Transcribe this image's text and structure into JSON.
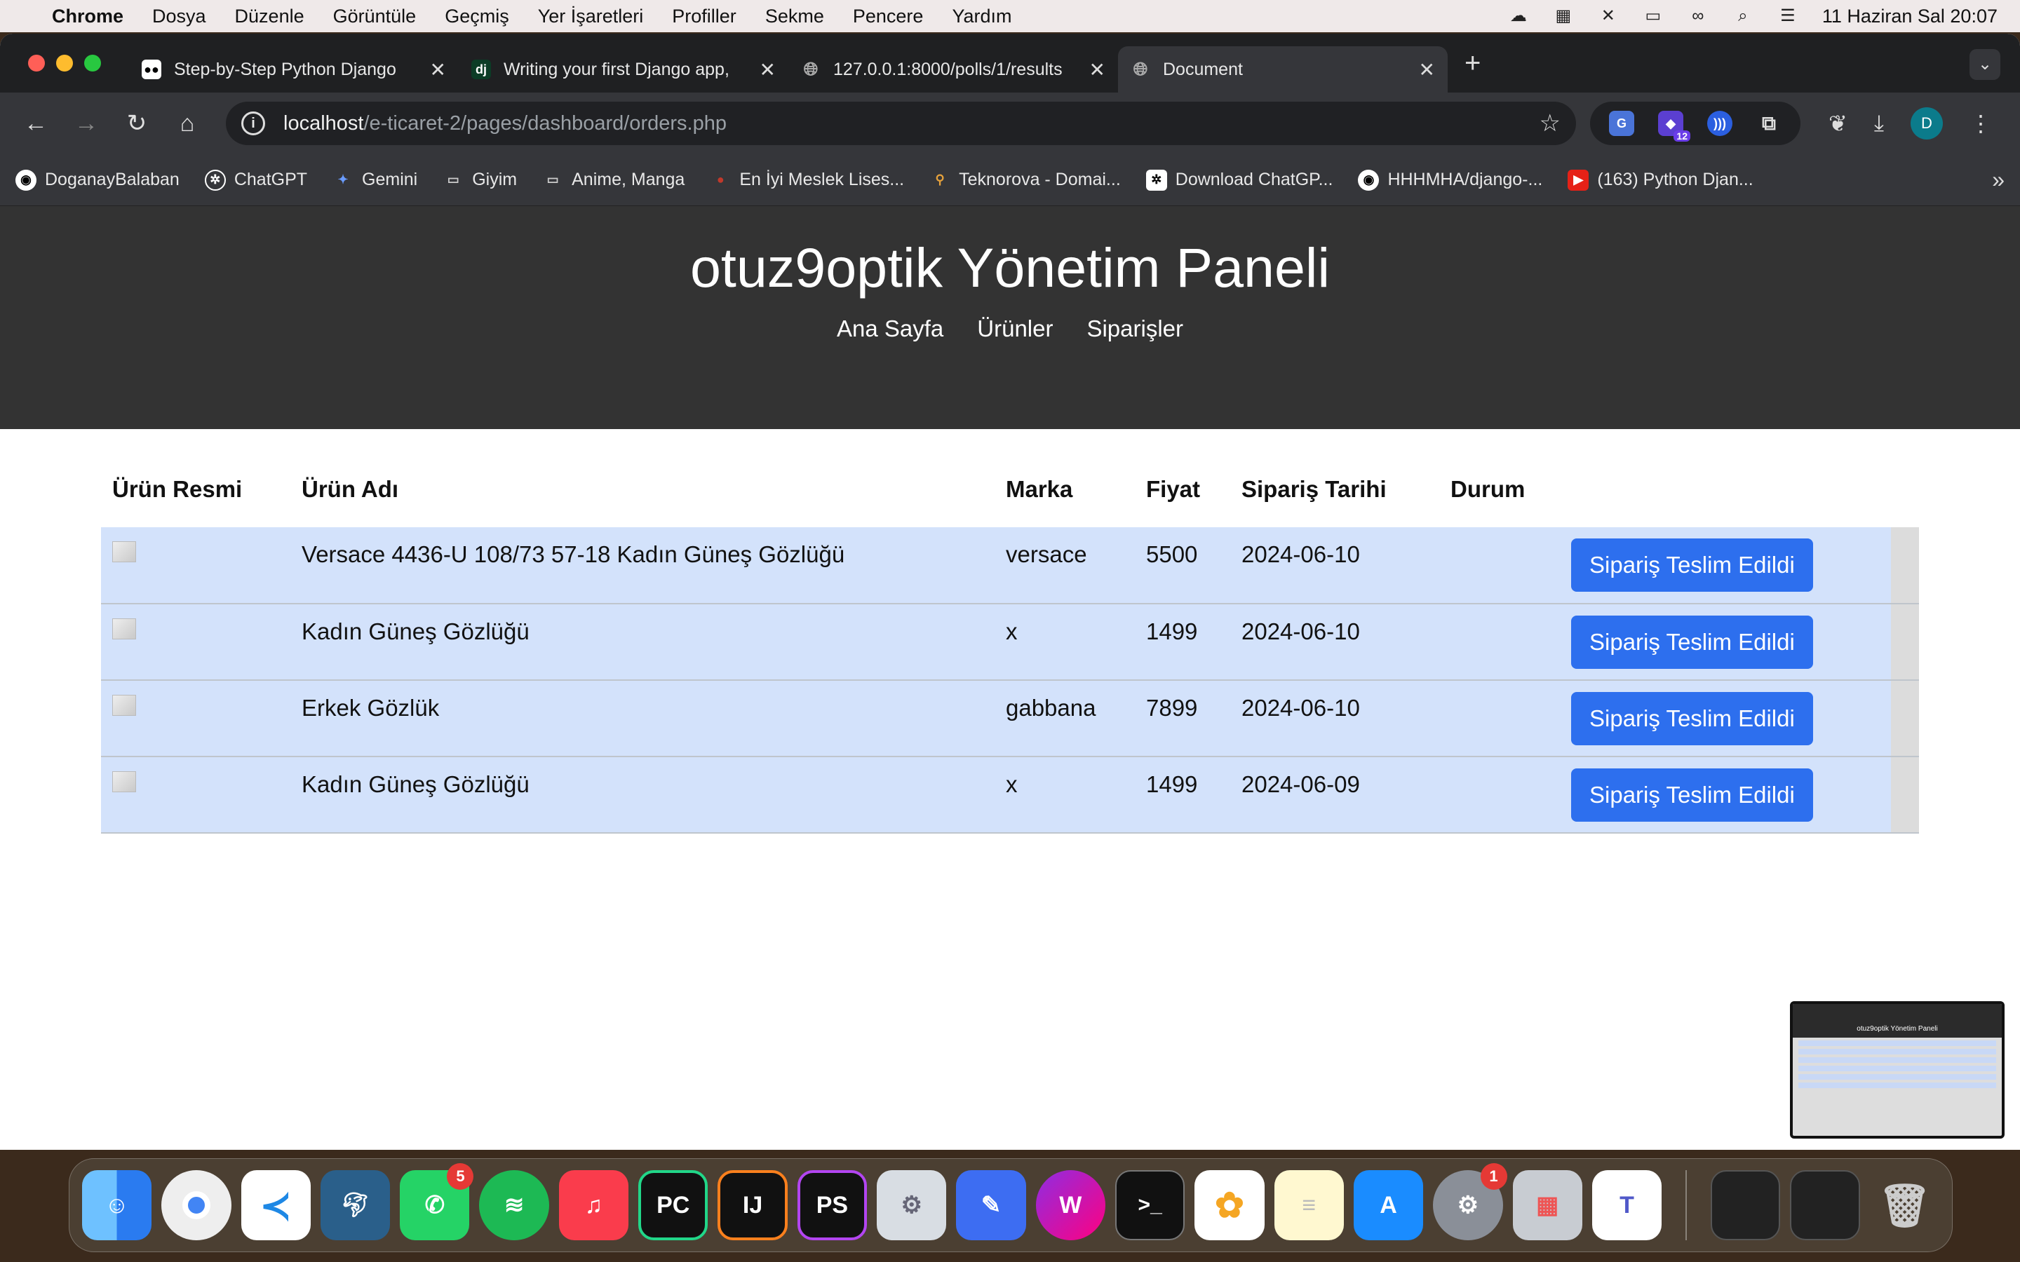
{
  "menubar": {
    "app": "Chrome",
    "items": [
      "Dosya",
      "Düzenle",
      "Görüntüle",
      "Geçmiş",
      "Yer İşaretleri",
      "Profiller",
      "Sekme",
      "Pencere",
      "Yardım"
    ],
    "datetime": "11 Haziran Sal  20:07"
  },
  "tabs": [
    {
      "title": "Step-by-Step Python Django",
      "icon": "medium-icon"
    },
    {
      "title": "Writing your first Django app,",
      "icon": "django-icon"
    },
    {
      "title": "127.0.0.1:8000/polls/1/results",
      "icon": "globe-icon"
    },
    {
      "title": "Document",
      "icon": "globe-icon"
    }
  ],
  "address": {
    "host": "localhost",
    "path": "/e-ticaret-2/pages/dashboard/orders.php"
  },
  "extensions": {
    "badge": "12"
  },
  "profile": {
    "initial": "D"
  },
  "bookmarks": [
    {
      "label": "DoganayBalaban",
      "icon": "github-icon"
    },
    {
      "label": "ChatGPT",
      "icon": "chatgpt-icon"
    },
    {
      "label": "Gemini",
      "icon": "gemini-icon"
    },
    {
      "label": "Giyim",
      "icon": "folder-icon"
    },
    {
      "label": "Anime, Manga",
      "icon": "folder-icon"
    },
    {
      "label": "En İyi Meslek Lises...",
      "icon": "site-icon"
    },
    {
      "label": "Teknorova - Domai...",
      "icon": "site-icon"
    },
    {
      "label": "Download ChatGP...",
      "icon": "chatgpt-icon"
    },
    {
      "label": "HHHMHA/django-...",
      "icon": "github-icon"
    },
    {
      "label": "(163) Python Djan...",
      "icon": "youtube-icon"
    }
  ],
  "site": {
    "title": "otuz9optik Yönetim Paneli",
    "nav": [
      "Ana Sayfa",
      "Ürünler",
      "Siparişler"
    ]
  },
  "orders": {
    "headers": [
      "Ürün Resmi",
      "Ürün Adı",
      "Marka",
      "Fiyat",
      "Sipariş Tarihi",
      "Durum"
    ],
    "button_label": "Sipariş Teslim Edildi",
    "rows": [
      {
        "name": "Versace 4436-U 108/73 57-18 Kadın Güneş Gözlüğü",
        "brand": "versace",
        "price": "5500",
        "date": "2024-06-10"
      },
      {
        "name": "Kadın Güneş Gözlüğü",
        "brand": "x",
        "price": "1499",
        "date": "2024-06-10"
      },
      {
        "name": "Erkek Gözlük",
        "brand": "gabbana",
        "price": "7899",
        "date": "2024-06-10"
      },
      {
        "name": "Kadın Güneş Gözlüğü",
        "brand": "x",
        "price": "1499",
        "date": "2024-06-09"
      }
    ]
  },
  "thumbnail": {
    "title": "otuz9optik Yönetim Paneli"
  },
  "dock": {
    "apps": [
      {
        "name": "Finder",
        "badge": ""
      },
      {
        "name": "Chrome",
        "badge": ""
      },
      {
        "name": "VS Code",
        "badge": ""
      },
      {
        "name": "MySQL Workbench",
        "badge": ""
      },
      {
        "name": "WhatsApp",
        "badge": "5"
      },
      {
        "name": "Spotify",
        "badge": ""
      },
      {
        "name": "Music",
        "badge": ""
      },
      {
        "name": "PyCharm",
        "badge": ""
      },
      {
        "name": "IntelliJ",
        "badge": ""
      },
      {
        "name": "PhpStorm",
        "badge": ""
      },
      {
        "name": "Settings Util",
        "badge": ""
      },
      {
        "name": "Pencil",
        "badge": ""
      },
      {
        "name": "Creative App",
        "badge": ""
      },
      {
        "name": "Terminal",
        "badge": ""
      },
      {
        "name": "Photos",
        "badge": ""
      },
      {
        "name": "Notes",
        "badge": ""
      },
      {
        "name": "App Store",
        "badge": ""
      },
      {
        "name": "System Settings",
        "badge": "1"
      },
      {
        "name": "Launchpad",
        "badge": ""
      },
      {
        "name": "Teams",
        "badge": ""
      }
    ]
  },
  "colors": {
    "accent": "#2d6fee",
    "row": "#d3e2fb",
    "header_bg": "#333333"
  }
}
